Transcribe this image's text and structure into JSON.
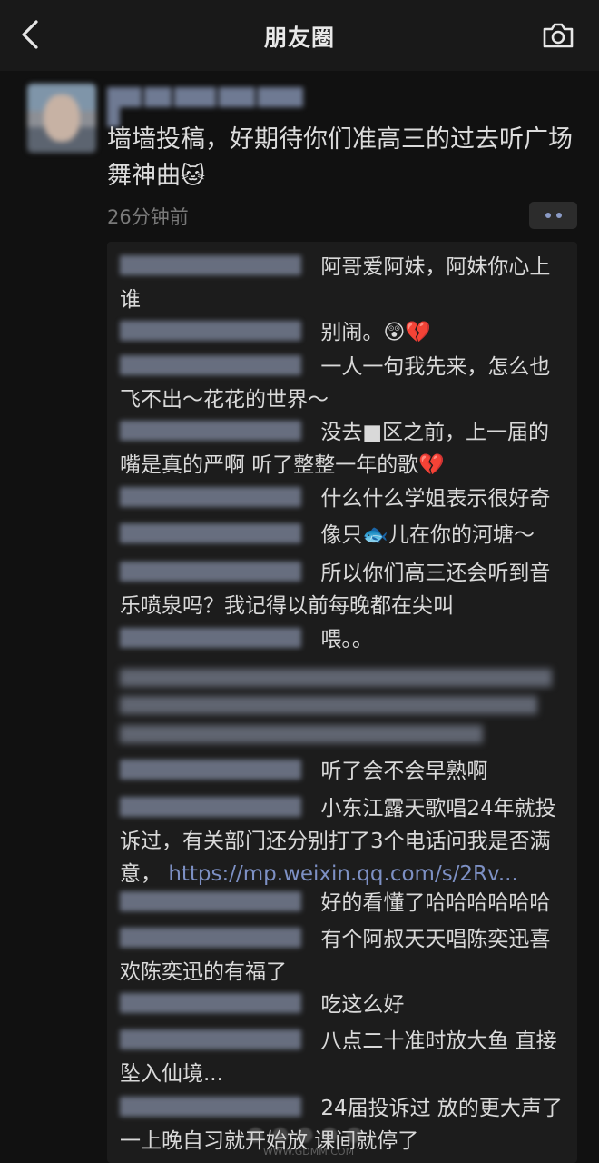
{
  "header": {
    "title": "朋友圈",
    "back_icon": "chevron-left-icon",
    "camera_icon": "camera-icon"
  },
  "post": {
    "text": "墙墙投稿，好期待你们准高三的过去听广场舞神曲",
    "emoji": "🐱",
    "time": "26分钟前"
  },
  "comments": [
    {
      "text": "阿哥爱阿妹，阿妹你心上谁"
    },
    {
      "text": "别闹。😲💔"
    },
    {
      "text": "一人一句我先来，怎么也飞不出～花花的世界～"
    },
    {
      "text": "没去■区之前，上一届的嘴是真的严啊 听了整整一年的歌💔"
    },
    {
      "text": "什么什么学姐表示很好奇"
    },
    {
      "text": "像只🐟儿在你的河塘～"
    },
    {
      "text": "所以你们高三还会听到音乐喷泉吗？我记得以前每晚都在尖叫"
    },
    {
      "text": "喂。。"
    },
    {
      "text": "听了会不会早熟啊"
    },
    {
      "text": "小东江露天歌唱24年就投诉过，有关部门还分别打了3个电话问我是否满意，",
      "link": "https://mp.weixin.qq.com/s/2Rv..."
    },
    {
      "text": "好的看懂了哈哈哈哈哈哈"
    },
    {
      "text": "有个阿叔天天唱陈奕迅喜欢陈奕迅的有福了"
    },
    {
      "text": "吃这么好"
    },
    {
      "text": "八点二十准时放大鱼 直接坠入仙境..."
    },
    {
      "text": "24届投诉过 放的更大声了 一上晚自习就开始放 课间就停了"
    }
  ],
  "watermark": "WWW.GDMM.COM",
  "colors": {
    "background": "#111111",
    "topbar": "#191919",
    "comment_bg": "#1c1c1c",
    "link": "#7d90c4"
  }
}
